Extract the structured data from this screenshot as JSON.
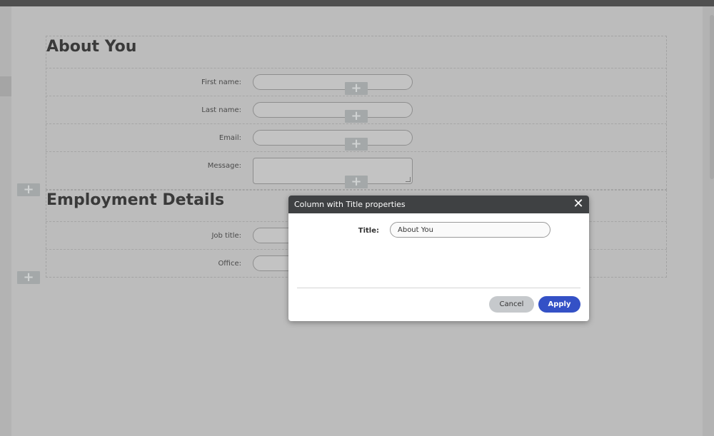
{
  "form": {
    "sections": [
      {
        "title": "About You",
        "fields": [
          {
            "label": "First name:"
          },
          {
            "label": "Last name:"
          },
          {
            "label": "Email:"
          },
          {
            "label": "Message:"
          }
        ]
      },
      {
        "title": "Employment Details",
        "fields": [
          {
            "label": "Job title:"
          },
          {
            "label": "Office:"
          }
        ]
      }
    ],
    "add_glyph": "+"
  },
  "dialog": {
    "title": "Column with Title properties",
    "close_glyph": "✕",
    "title_field_label": "Title:",
    "title_field_value": "About You",
    "cancel_label": "Cancel",
    "apply_label": "Apply"
  },
  "colors": {
    "overlay_background": "#bdbdbd",
    "dialog_header": "#3f4143",
    "apply_button": "#3451c6",
    "cancel_button": "#c6c9cc"
  }
}
